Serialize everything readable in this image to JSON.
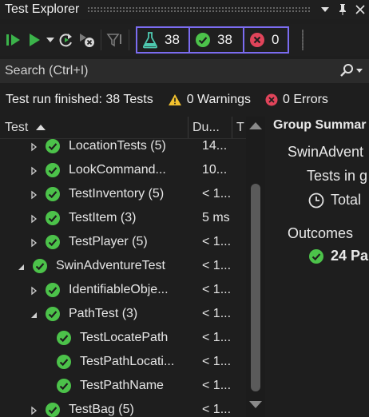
{
  "window": {
    "title": "Test Explorer"
  },
  "toolbar": {
    "counters": {
      "total": "38",
      "passed": "38",
      "failed": "0"
    }
  },
  "search": {
    "placeholder": "Search (Ctrl+I)"
  },
  "status": {
    "summary": "Test run finished: 38 Tests",
    "warnings": "0 Warnings",
    "errors": "0 Errors"
  },
  "tree": {
    "columns": {
      "test": "Test",
      "duration": "Du...",
      "traits": "T"
    },
    "rows": [
      {
        "name": "LocationTests (5)",
        "duration": "14...",
        "level": 2,
        "expander": "collapsed"
      },
      {
        "name": "LookCommand...",
        "duration": "10...",
        "level": 2,
        "expander": "collapsed"
      },
      {
        "name": "TestInventory (5)",
        "duration": "< 1...",
        "level": 2,
        "expander": "collapsed"
      },
      {
        "name": "TestItem (3)",
        "duration": "5 ms",
        "level": 2,
        "expander": "collapsed"
      },
      {
        "name": "TestPlayer (5)",
        "duration": "< 1...",
        "level": 2,
        "expander": "collapsed"
      },
      {
        "name": "SwinAdventureTest",
        "duration": "< 1...",
        "level": 1,
        "expander": "expanded"
      },
      {
        "name": "IdentifiableObje...",
        "duration": "< 1...",
        "level": 2,
        "expander": "collapsed"
      },
      {
        "name": "PathTest (3)",
        "duration": "< 1...",
        "level": 2,
        "expander": "expanded"
      },
      {
        "name": "TestLocatePath",
        "duration": "< 1...",
        "level": 3,
        "expander": "none"
      },
      {
        "name": "TestPathLocati...",
        "duration": "< 1...",
        "level": 3,
        "expander": "none"
      },
      {
        "name": "TestPathName",
        "duration": "< 1...",
        "level": 3,
        "expander": "none"
      },
      {
        "name": "TestBag (5)",
        "duration": "< 1...",
        "level": 2,
        "expander": "collapsed"
      }
    ]
  },
  "summary": {
    "title": "Group Summar",
    "group": "SwinAdvent",
    "tests_in": "Tests in g",
    "total": "Total",
    "outcomes": "Outcomes",
    "passed": "24 Pa"
  },
  "colors": {
    "pass_green": "#4cc24a",
    "fail_red": "#e0445a",
    "flask_teal": "#4ec9b0",
    "counter_border": "#7b6cf0",
    "run_green": "#3bb34a",
    "warning_yellow": "#f2c12e"
  }
}
